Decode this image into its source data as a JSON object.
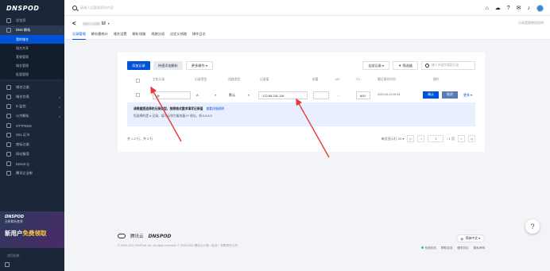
{
  "sidebar": {
    "logo": "DNSPOD",
    "items": [
      {
        "label": "总览页",
        "arrow": ""
      },
      {
        "label": "DNS 解析",
        "arrow": "^"
      }
    ],
    "sub_items": [
      {
        "label": "我的域名",
        "active": true
      },
      {
        "label": "域名共享"
      },
      {
        "label": "套餐管理"
      },
      {
        "label": "域名管理"
      },
      {
        "label": "批量管理"
      }
    ],
    "items2": [
      {
        "label": "域名注册",
        "arrow": ""
      },
      {
        "label": "域名交易",
        "arrow": "v"
      },
      {
        "label": "D 监控",
        "arrow": "v"
      },
      {
        "label": "公共解析",
        "arrow": "v"
      },
      {
        "label": "HTTPDNS",
        "arrow": ""
      },
      {
        "label": "SSL 证书",
        "arrow": ""
      },
      {
        "label": "商标注册",
        "arrow": ""
      },
      {
        "label": "网站备案",
        "arrow": ""
      },
      {
        "label": "Dnsort Q",
        "arrow": ""
      },
      {
        "label": "腾讯企业邮",
        "arrow": ""
      }
    ],
    "promo": {
      "logo": "DNSPOD",
      "sub": "全新解析套餐",
      "title_a": "新用户",
      "title_b": "免费领取"
    },
    "bottom_text": "...使用指南..."
  },
  "topbar": {
    "search_placeholder": "请输入您要搜索的内容",
    "icons": [
      "home-icon",
      "cloud-icon",
      "help-icon",
      "chat-icon",
      "bell-icon",
      "avatar"
    ]
  },
  "domain": {
    "back": "<",
    "suffix": "td",
    "caret": "▾",
    "right_link": "记录管理使用说明"
  },
  "tabs": [
    "记录管理",
    "解析量统计",
    "域名设置",
    "解析线路",
    "线路分组",
    "自定义线路",
    "操作日志"
  ],
  "toolbar": {
    "add": "添加记录",
    "quick": "快速添加解析",
    "more": "更多操作 ▾",
    "all_records": "全部记录 ▾",
    "filter": "▼ 筛选器",
    "search_placeholder": "输入关键字搜索记录"
  },
  "table": {
    "headers": [
      "主机记录",
      "记录类型",
      "线路类型",
      "记录值",
      "权重",
      "MX",
      "TTL",
      "最后操作时间",
      "操作"
    ],
    "row": {
      "host": "@",
      "type": "A",
      "line": "默认",
      "value": "172.65.241.116",
      "weight": "",
      "mx": "-",
      "ttl": "600",
      "time": "2021-04-23 09:44",
      "confirm": "确认",
      "cancel": "取消",
      "more": "更多 ▾"
    }
  },
  "hint": {
    "title": "请根据您选择的记录类型，按照格式要求填写记录值",
    "link": "查看详细说明",
    "desc": "您选择的是 A 记录，填写示例为服务器 IP 地址，如 8.8.8.8"
  },
  "pagination": {
    "summary": "共 1-2 行，共 2 行",
    "page_size": "每页显示行 20 ▾",
    "first": "|<",
    "prev": "<",
    "page": "1",
    "total": "/ 1 页",
    "next": ">",
    "last": ">|"
  },
  "footer": {
    "brand_a": "腾讯云",
    "brand_b": "DNSPOD",
    "copyright": "© 2006-2021 DNSPod, Inc. All rights reserved. © 2006-2021 腾讯云计算（北京）有限责任公司",
    "lang": "简体中文 ▾",
    "links": [
      "系统状态",
      "帮助支持",
      "服务协议",
      "隐私声明"
    ]
  },
  "help_button": "?",
  "colors": {
    "primary": "#0052d9",
    "sidebar": "#1b2638",
    "hint_bg": "#e8efff",
    "annotation": "#e53935"
  }
}
